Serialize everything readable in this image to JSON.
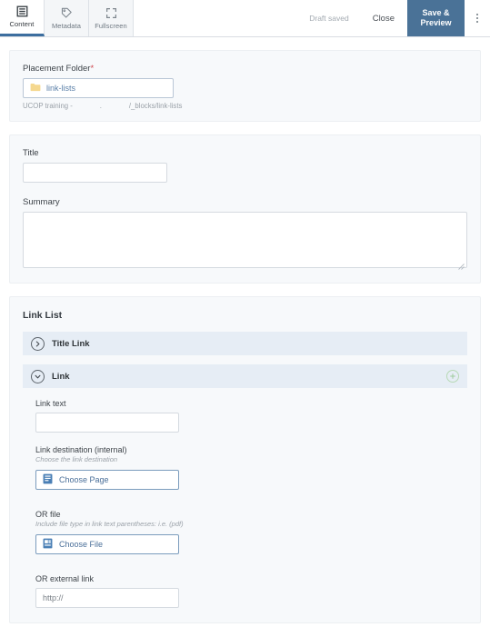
{
  "toolbar": {
    "tabs": [
      {
        "label": "Content",
        "icon": "content-list-icon",
        "active": true
      },
      {
        "label": "Metadata",
        "icon": "tag-icon",
        "active": false
      },
      {
        "label": "Fullscreen",
        "icon": "fullscreen-icon",
        "active": false
      }
    ],
    "draft_status": "Draft saved",
    "close_label": "Close",
    "save_preview_line1": "Save &",
    "save_preview_line2": "Preview",
    "overflow_icon": "kebab-menu-icon"
  },
  "placement": {
    "label": "Placement Folder",
    "required_marker": "*",
    "folder_icon": "folder-icon",
    "folder_value": "link-lists",
    "helper_left": "UCOP training -",
    "helper_mid": ".",
    "helper_right": "/_blocks/link-lists"
  },
  "meta": {
    "title_label": "Title",
    "title_value": "",
    "summary_label": "Summary",
    "summary_value": ""
  },
  "link_list": {
    "section_title": "Link List",
    "title_link": {
      "label": "Title Link",
      "chevron_icon": "chevron-right-icon"
    },
    "link": {
      "label": "Link",
      "chevron_icon": "chevron-down-icon",
      "add_icon": "plus-circle-icon"
    },
    "fields": {
      "link_text_label": "Link text",
      "link_text_value": "",
      "destination_label": "Link destination (internal)",
      "destination_helper": "Choose the link destination",
      "choose_page_label": "Choose Page",
      "choose_page_icon": "page-document-icon",
      "or_file_label": "OR file",
      "or_file_helper": "Include file type in link text parentheses: i.e. (pdf)",
      "choose_file_label": "Choose File",
      "choose_file_icon": "file-document-icon",
      "external_label": "OR external link",
      "external_value": "http://"
    }
  },
  "colors": {
    "accent_blue": "#4a7297",
    "accordion_bg": "#e6edf5",
    "panel_bg": "#f7f9fb",
    "folder_yellow": "#f5d88f",
    "required_red": "#d0454c",
    "add_green": "#b7d9b5"
  }
}
